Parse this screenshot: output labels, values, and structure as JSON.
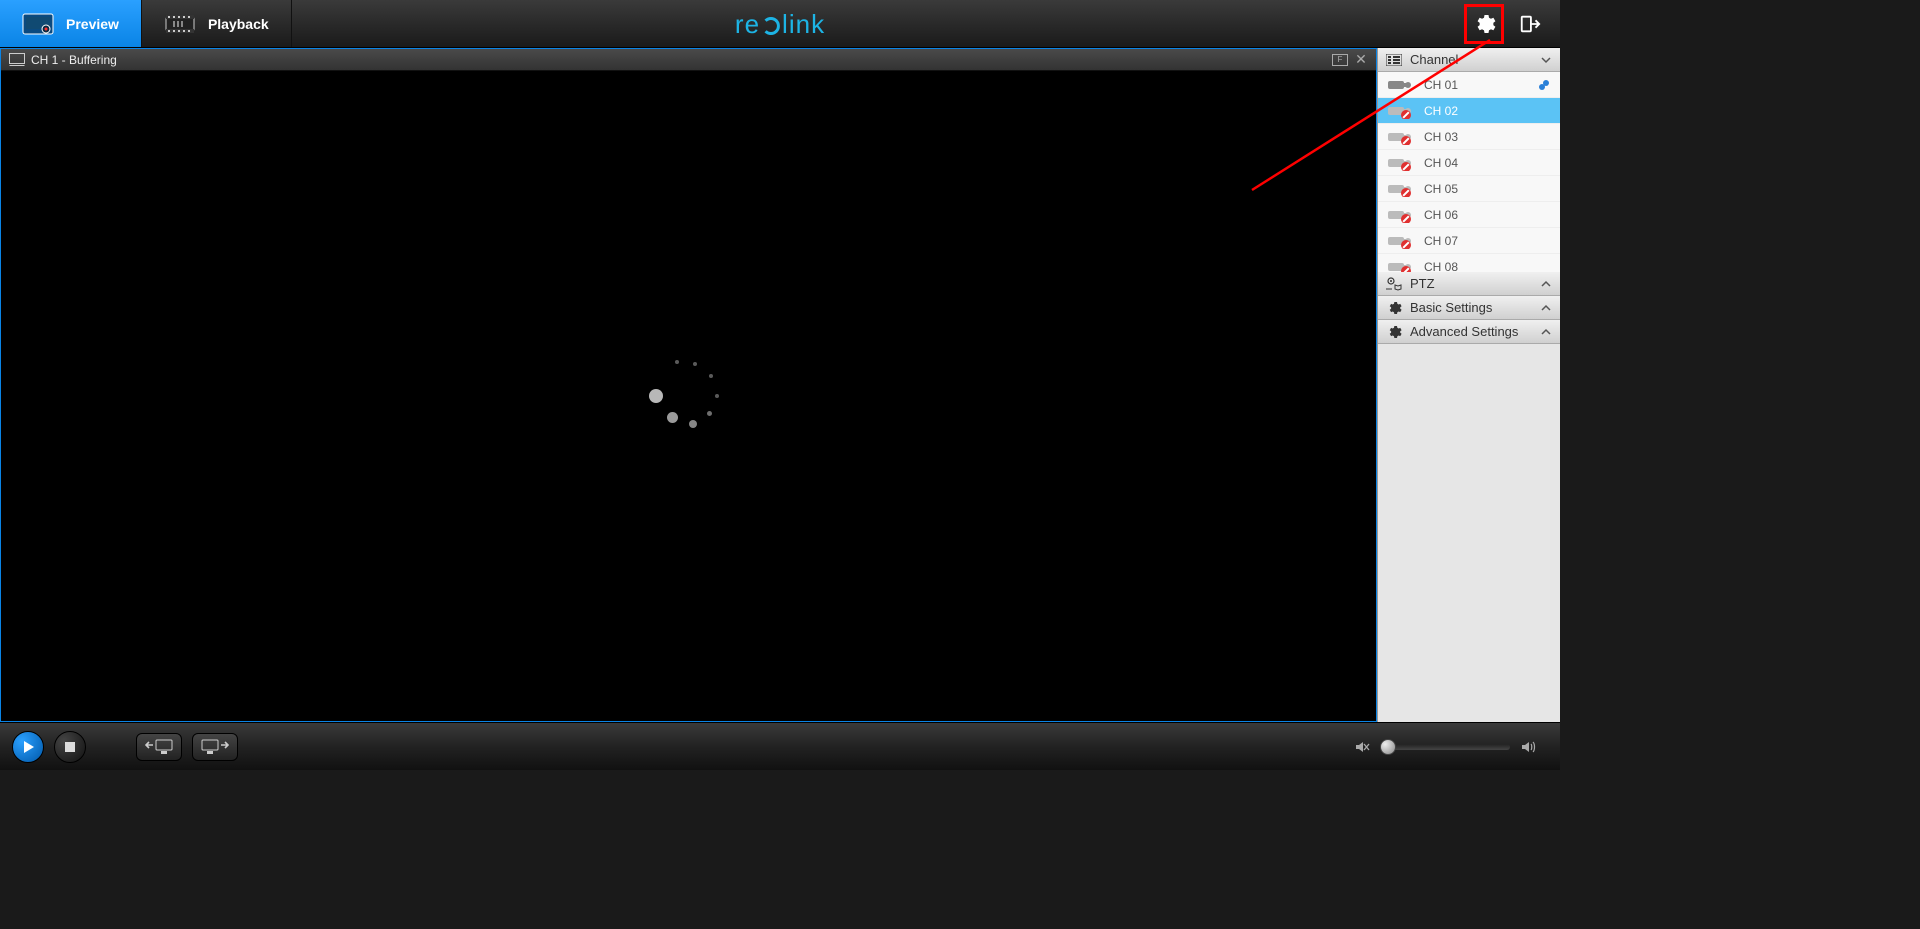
{
  "tabs": {
    "preview": "Preview",
    "playback": "Playback"
  },
  "brand_parts": {
    "a": "re",
    "b": "link"
  },
  "video_header": {
    "title": "CH 1 - Buffering",
    "fs_letter": "F"
  },
  "sidebar": {
    "channel_header": "Channel",
    "ptz_header": "PTZ",
    "basic_header": "Basic Settings",
    "adv_header": "Advanced Settings",
    "channels": [
      {
        "label": "CH 01",
        "active": true,
        "selected": false,
        "go": true
      },
      {
        "label": "CH 02",
        "active": false,
        "selected": true,
        "go": false
      },
      {
        "label": "CH 03",
        "active": false,
        "selected": false,
        "go": false
      },
      {
        "label": "CH 04",
        "active": false,
        "selected": false,
        "go": false
      },
      {
        "label": "CH 05",
        "active": false,
        "selected": false,
        "go": false
      },
      {
        "label": "CH 06",
        "active": false,
        "selected": false,
        "go": false
      },
      {
        "label": "CH 07",
        "active": false,
        "selected": false,
        "go": false
      },
      {
        "label": "CH 08",
        "active": false,
        "selected": false,
        "go": false
      }
    ]
  }
}
